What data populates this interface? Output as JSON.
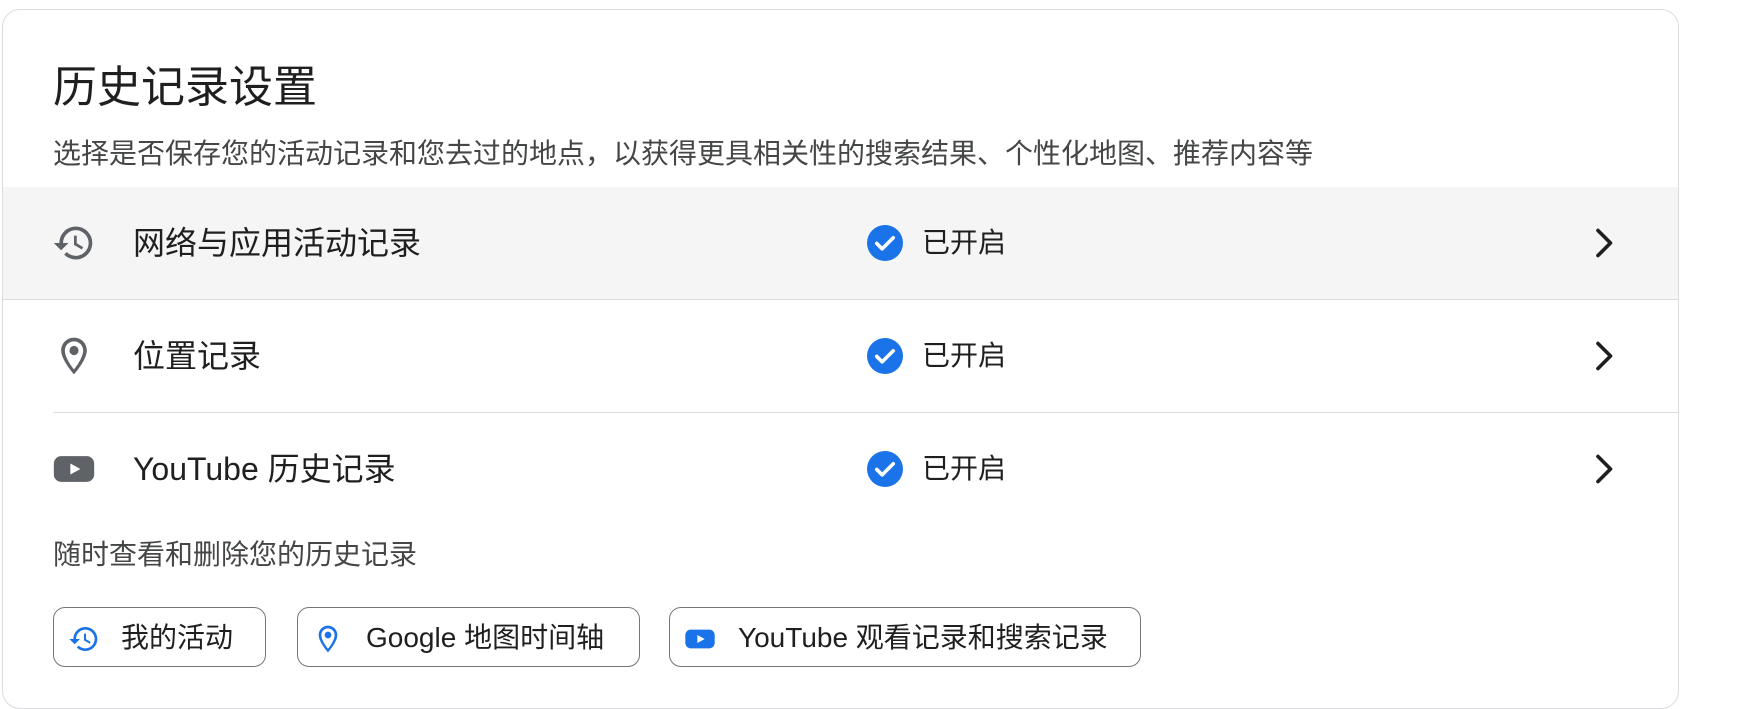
{
  "header": {
    "title": "历史记录设置",
    "subtitle": "选择是否保存您的活动记录和您去过的地点，以获得更具相关性的搜索结果、个性化地图、推荐内容等"
  },
  "settings": [
    {
      "icon": "history-icon",
      "label": "网络与应用活动记录",
      "status": "已开启"
    },
    {
      "icon": "location-pin-icon",
      "label": "位置记录",
      "status": "已开启"
    },
    {
      "icon": "youtube-icon",
      "label": "YouTube 历史记录",
      "status": "已开启"
    }
  ],
  "review": {
    "label": "随时查看和删除您的历史记录",
    "chips": [
      {
        "icon": "history-icon",
        "label": "我的活动"
      },
      {
        "icon": "location-pin-icon",
        "label": "Google 地图时间轴"
      },
      {
        "icon": "youtube-icon",
        "label": "YouTube 观看记录和搜索记录"
      }
    ]
  },
  "colors": {
    "accent_blue": "#1a73e8",
    "icon_gray": "#5f6368",
    "row_hover": "#f5f5f5",
    "border": "#dadce0"
  }
}
